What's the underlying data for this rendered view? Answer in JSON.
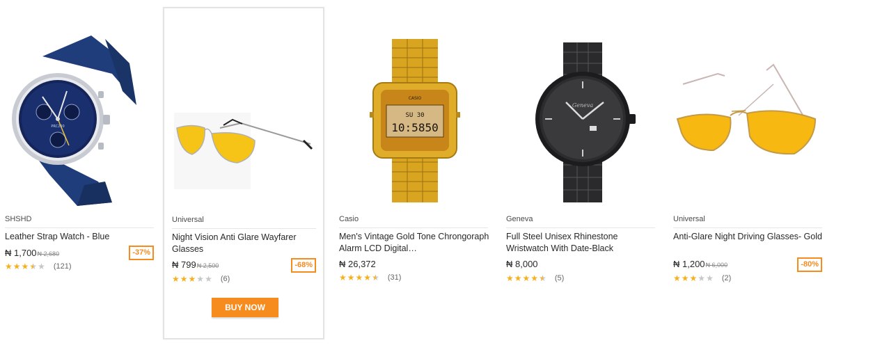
{
  "products": [
    {
      "brand": "SHSHD",
      "title": "Leather Strap Watch - Blue",
      "price": "₦ 1,700",
      "old_price": "₦ 2,680",
      "discount": "-37%",
      "rating_stars": 3.5,
      "reviews": "(121)",
      "image": "blue-leather-watch"
    },
    {
      "brand": "Universal",
      "title": "Night Vision Anti Glare Wayfarer Glasses",
      "price": "₦ 799",
      "old_price": "₦ 2,500",
      "discount": "-68%",
      "rating_stars": 3,
      "reviews": "(6)",
      "image": "yellow-aviator-glasses",
      "buy_label": "BUY NOW"
    },
    {
      "brand": "Casio",
      "title": "Men's Vintage Gold Tone Chrongoraph Alarm LCD Digital…",
      "price": "₦ 26,372",
      "old_price": "",
      "discount": "",
      "rating_stars": 4.5,
      "reviews": "(31)",
      "image": "gold-digital-watch",
      "lcd_top": "SU 30",
      "lcd_main": "10:5850"
    },
    {
      "brand": "Geneva",
      "title": "Full Steel Unisex Rhinestone Wristwatch With Date-Black",
      "price": "₦ 8,000",
      "old_price": "",
      "discount": "",
      "rating_stars": 4.5,
      "reviews": "(5)",
      "image": "black-steel-watch"
    },
    {
      "brand": "Universal",
      "title": "Anti-Glare Night Driving Glasses- Gold",
      "price": "₦ 1,200",
      "old_price": "₦ 6,000",
      "discount": "-80%",
      "rating_stars": 3,
      "reviews": "(2)",
      "image": "yellow-aviator-glasses-large"
    }
  ],
  "colors": {
    "accent": "#f68b1e",
    "star": "#f6b01e",
    "star_empty": "#c7c7c7"
  }
}
